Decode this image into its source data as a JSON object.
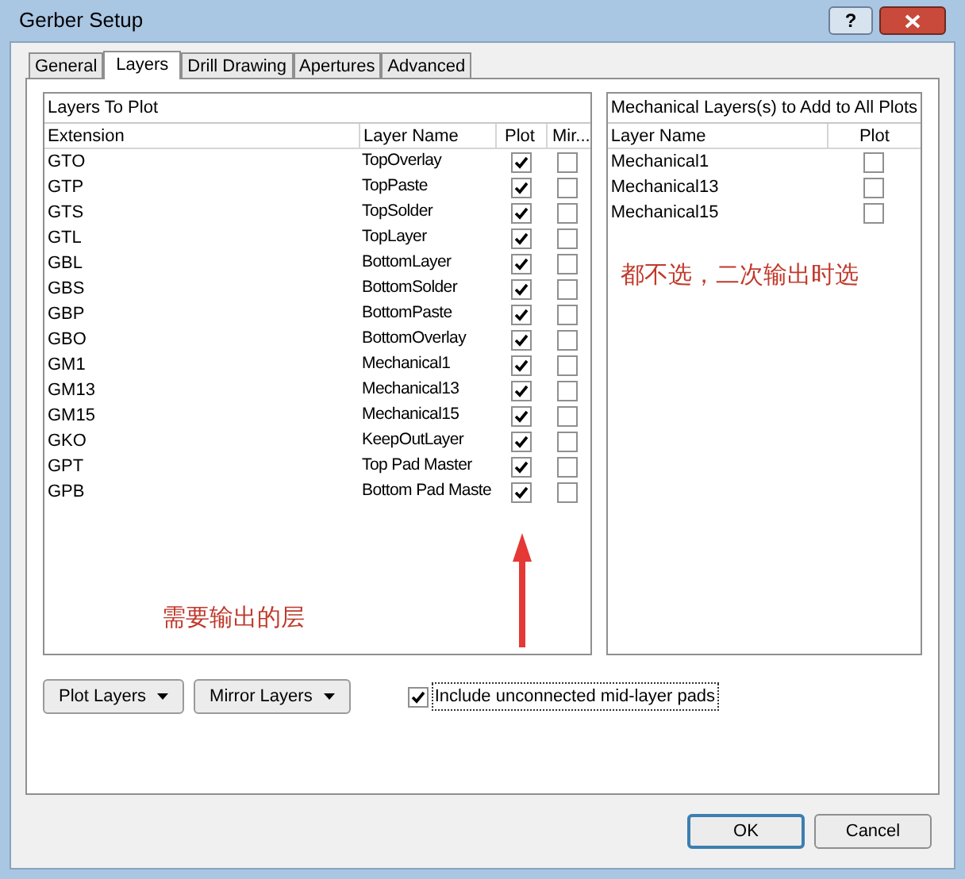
{
  "window": {
    "title": "Gerber Setup",
    "help_button": "?"
  },
  "tabs": [
    {
      "label": "General",
      "selected": false
    },
    {
      "label": "Layers",
      "selected": true
    },
    {
      "label": "Drill Drawing",
      "selected": false
    },
    {
      "label": "Apertures",
      "selected": false
    },
    {
      "label": "Advanced",
      "selected": false
    }
  ],
  "layers_to_plot": {
    "title": "Layers To Plot",
    "columns": [
      "Extension",
      "Layer Name",
      "Plot",
      "Mir..."
    ],
    "rows": [
      {
        "extension": "GTO",
        "layer_name": "TopOverlay",
        "plot": true,
        "mirror": false
      },
      {
        "extension": "GTP",
        "layer_name": "TopPaste",
        "plot": true,
        "mirror": false
      },
      {
        "extension": "GTS",
        "layer_name": "TopSolder",
        "plot": true,
        "mirror": false
      },
      {
        "extension": "GTL",
        "layer_name": "TopLayer",
        "plot": true,
        "mirror": false
      },
      {
        "extension": "GBL",
        "layer_name": "BottomLayer",
        "plot": true,
        "mirror": false
      },
      {
        "extension": "GBS",
        "layer_name": "BottomSolder",
        "plot": true,
        "mirror": false
      },
      {
        "extension": "GBP",
        "layer_name": "BottomPaste",
        "plot": true,
        "mirror": false
      },
      {
        "extension": "GBO",
        "layer_name": "BottomOverlay",
        "plot": true,
        "mirror": false
      },
      {
        "extension": "GM1",
        "layer_name": "Mechanical1",
        "plot": true,
        "mirror": false
      },
      {
        "extension": "GM13",
        "layer_name": "Mechanical13",
        "plot": true,
        "mirror": false
      },
      {
        "extension": "GM15",
        "layer_name": "Mechanical15",
        "plot": true,
        "mirror": false
      },
      {
        "extension": "GKO",
        "layer_name": "KeepOutLayer",
        "plot": true,
        "mirror": false
      },
      {
        "extension": "GPT",
        "layer_name": "Top Pad Master",
        "plot": true,
        "mirror": false
      },
      {
        "extension": "GPB",
        "layer_name": "Bottom Pad Maste",
        "plot": true,
        "mirror": false
      }
    ],
    "annotation": "需要输出的层"
  },
  "mechanical_layers": {
    "title": "Mechanical Layers(s) to Add to All Plots",
    "columns": [
      "Layer Name",
      "Plot"
    ],
    "rows": [
      {
        "layer_name": "Mechanical1",
        "plot": false
      },
      {
        "layer_name": "Mechanical13",
        "plot": false
      },
      {
        "layer_name": "Mechanical15",
        "plot": false
      }
    ],
    "annotation": "都不选，二次输出时选"
  },
  "buttons": [
    {
      "label": "Plot Layers"
    },
    {
      "label": "Mirror Layers"
    }
  ],
  "include_pads": {
    "label": "Include unconnected mid-layer pads",
    "checked": true
  },
  "footer_buttons": [
    {
      "label": "OK",
      "default": true
    },
    {
      "label": "Cancel",
      "default": false
    }
  ]
}
